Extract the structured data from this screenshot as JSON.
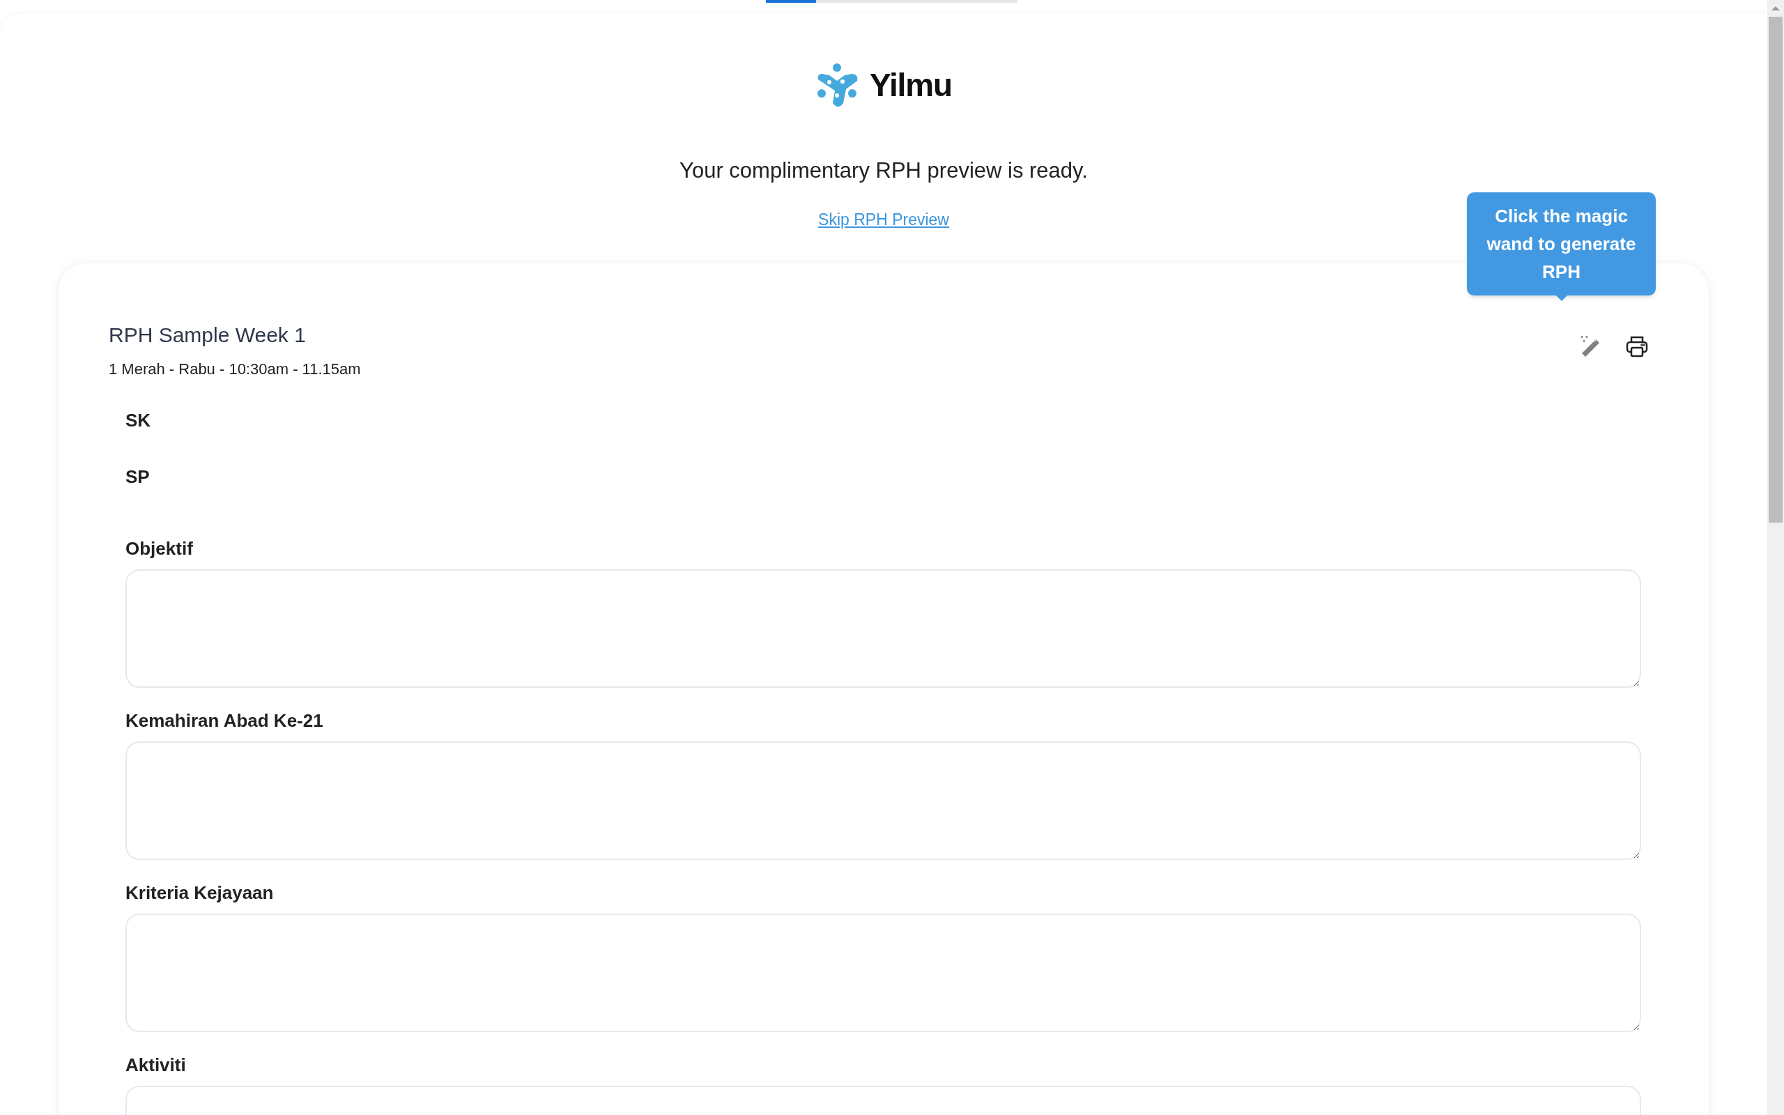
{
  "progress": {
    "level": 0.2
  },
  "logo": {
    "text": "Yilmu"
  },
  "message": "Your complimentary RPH preview is ready.",
  "skip_link": "Skip RPH Preview",
  "tooltip": "Click the magic wand to generate RPH",
  "card": {
    "title": "RPH Sample Week 1",
    "subtitle": "1 Merah - Rabu - 10:30am - 11.15am",
    "sections": [
      {
        "kind": "heading",
        "label": "SK"
      },
      {
        "kind": "heading",
        "label": "SP"
      },
      {
        "kind": "textarea",
        "label": "Objektif"
      },
      {
        "kind": "textarea",
        "label": "Kemahiran Abad Ke-21"
      },
      {
        "kind": "textarea",
        "label": "Kriteria Kejayaan"
      },
      {
        "kind": "textarea",
        "label": "Aktiviti"
      }
    ]
  }
}
